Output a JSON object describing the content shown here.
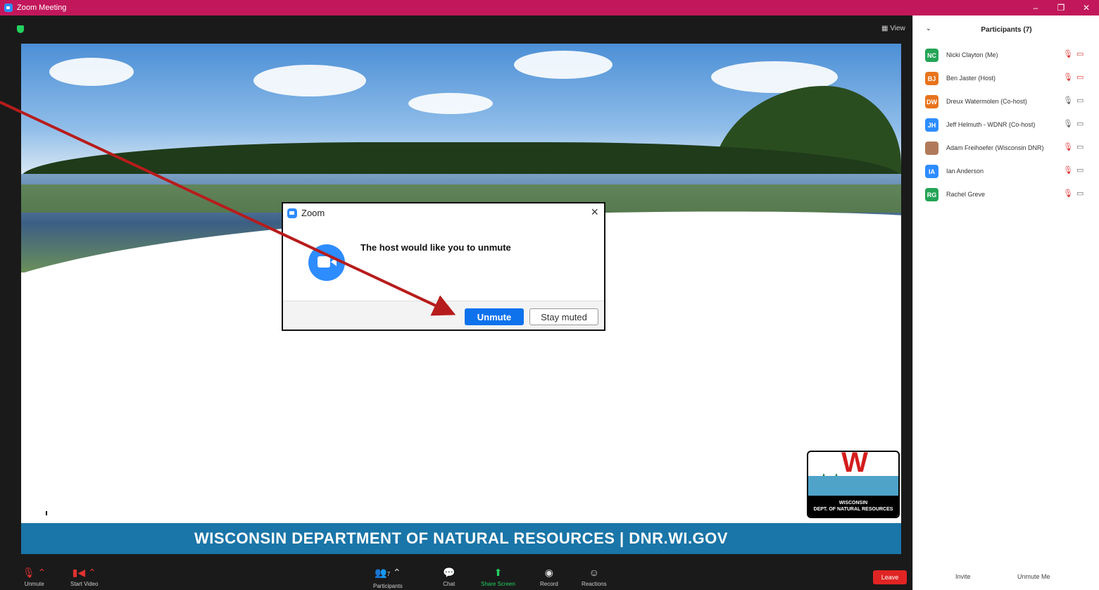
{
  "window": {
    "title": "Zoom Meeting",
    "controls": [
      "–",
      "❐",
      "✕"
    ]
  },
  "meeting": {
    "view_label": "View",
    "slide_banner": "WISCONSIN DEPARTMENT OF NATURAL RESOURCES | DNR.WI.GOV",
    "logo_text_line1": "WISCONSIN",
    "logo_text_line2": "DEPT. OF NATURAL RESOURCES"
  },
  "dialog": {
    "title": "Zoom",
    "message": "The host would like you to unmute",
    "unmute_label": "Unmute",
    "stay_label": "Stay muted"
  },
  "toolbar": {
    "unmute": "Unmute",
    "start_video": "Start Video",
    "participants": "Participants",
    "participants_count": "7",
    "chat": "Chat",
    "share_screen": "Share Screen",
    "record": "Record",
    "reactions": "Reactions",
    "leave": "Leave"
  },
  "participants_panel": {
    "title": "Participants (7)",
    "invite": "Invite",
    "unmute_me": "Unmute Me",
    "list": [
      {
        "initials": "NC",
        "name": "Nicki Clayton (Me)",
        "color": "#23a455",
        "mic": "muted",
        "cam": "off"
      },
      {
        "initials": "BJ",
        "name": "Ben Jaster (Host)",
        "color": "#e8741c",
        "mic": "muted",
        "cam": "off"
      },
      {
        "initials": "DW",
        "name": "Dreux Watermolen (Co-host)",
        "color": "#e8741c",
        "mic": "on",
        "cam": "on"
      },
      {
        "initials": "JH",
        "name": "Jeff Helmuth - WDNR (Co-host)",
        "color": "#2d8cff",
        "mic": "on",
        "cam": "on"
      },
      {
        "initials": "",
        "name": "Adam Freihoefer (Wisconsin DNR)",
        "color": "#b07a5a",
        "mic": "muted",
        "cam": "on"
      },
      {
        "initials": "IA",
        "name": "Ian Anderson",
        "color": "#2d8cff",
        "mic": "muted",
        "cam": "on"
      },
      {
        "initials": "RG",
        "name": "Rachel Greve",
        "color": "#23a455",
        "mic": "muted",
        "cam": "on"
      }
    ]
  }
}
